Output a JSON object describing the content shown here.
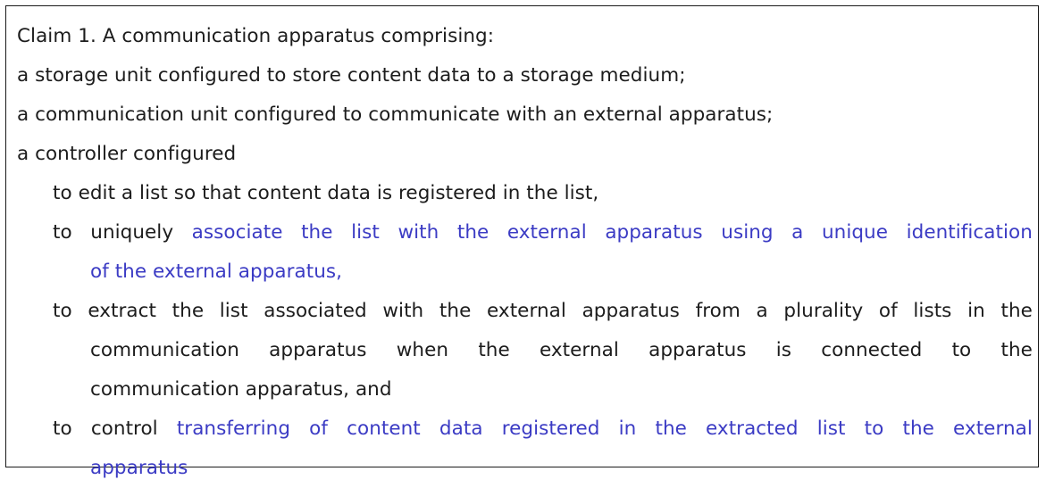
{
  "document": {
    "type": "patent-claim",
    "border_color": "#1a1a1a",
    "background_color": "#ffffff",
    "text_color": "#1c1c1c",
    "highlight_color": "#3b3bc4",
    "full_text": "Claim 1. A communication apparatus comprising: a storage unit configured to store content data to a storage medium; a communication unit configured to communicate with an external apparatus; a controller configured to edit a list so that content data is registered in the list, to uniquely associate the list with the external apparatus using a unique identification of the external apparatus, to extract the list associated with the external apparatus from a plurality of lists in the communication apparatus when the external apparatus is connected to the communication apparatus, and to control transferring of content data registered in the extracted list to the external apparatus"
  },
  "lines": {
    "l1": "Claim 1. A communication apparatus comprising:",
    "l2": "a storage unit configured to store content data to a storage medium;",
    "l3": "a communication unit configured to communicate with an external apparatus;",
    "l4": "a controller configured",
    "l5": "to edit a list so that content data is registered in the list,",
    "l6_black": "to uniquely",
    "l6_blue": "associate the list with the external apparatus using a unique identification",
    "l7_blue": "of the external apparatus,",
    "l8": "to extract the list associated with the external apparatus from a plurality of lists in the",
    "l9": "communication apparatus when the external apparatus is connected to the",
    "l10": "communication apparatus, and",
    "l11_black": "to control",
    "l11_blue": "transferring of content data registered in the extracted list to the external",
    "l12_blue": "apparatus"
  },
  "words": {
    "line1": [
      "Claim",
      "1.",
      "A",
      "communication",
      "apparatus",
      "comprising:"
    ],
    "line2": [
      "a",
      "storage",
      "unit",
      "configured",
      "to",
      "store",
      "content",
      "data",
      "to",
      "a",
      "storage",
      "medium;"
    ],
    "line3": [
      "a",
      "communication",
      "unit",
      "configured",
      "to",
      "communicate",
      "with",
      "an",
      "external",
      "apparatus;"
    ],
    "line4": [
      "a",
      "controller",
      "configured"
    ],
    "line5": [
      "to",
      "edit",
      "a",
      "list",
      "so",
      "that",
      "content",
      "data",
      "is",
      "registered",
      "in",
      "the",
      "list,"
    ],
    "line6": [
      "to",
      "uniquely",
      "associate",
      "the",
      "list",
      "with",
      "the",
      "external",
      "apparatus",
      "using",
      "a",
      "unique",
      "identification"
    ],
    "line7": [
      "of",
      "the",
      "external",
      "apparatus,"
    ],
    "line8": [
      "to",
      "extract",
      "the",
      "list",
      "associated",
      "with",
      "the",
      "external",
      "apparatus",
      "from",
      "a",
      "plurality",
      "of",
      "lists",
      "in",
      "the"
    ],
    "line9": [
      "communication",
      "apparatus",
      "when",
      "the",
      "external",
      "apparatus",
      "is",
      "connected",
      "to",
      "the"
    ],
    "line10": [
      "communication",
      "apparatus,",
      "and"
    ],
    "line11": [
      "to",
      "control",
      "transferring",
      "of",
      "content",
      "data",
      "registered",
      "in",
      "the",
      "extracted",
      "list",
      "to",
      "the",
      "external"
    ],
    "line12": [
      "apparatus"
    ]
  }
}
